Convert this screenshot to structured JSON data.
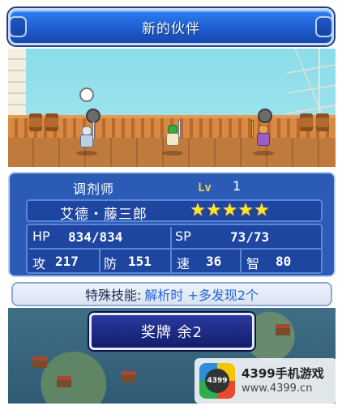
{
  "title": "新的伙伴",
  "character": {
    "job": "调剂师",
    "lv_label": "Lv",
    "lv_value": "1",
    "name": "艾德・藤三郎",
    "stars": "★★★★★",
    "star_rating": 5,
    "hp_label": "HP",
    "hp_value": "834/834",
    "sp_label": "SP",
    "sp_value": "73/73",
    "atk_label": "攻",
    "atk_value": "217",
    "def_label": "防",
    "def_value": "151",
    "spd_label": "速",
    "spd_value": "36",
    "int_label": "智",
    "int_value": "80"
  },
  "skill": {
    "label": "特殊技能:",
    "value": "解析时 +多发现2个"
  },
  "medal_button": "奖牌 余2",
  "watermark": {
    "logo_text": "4399",
    "title": "4399手机游戏",
    "url": "www.4399.cn"
  }
}
